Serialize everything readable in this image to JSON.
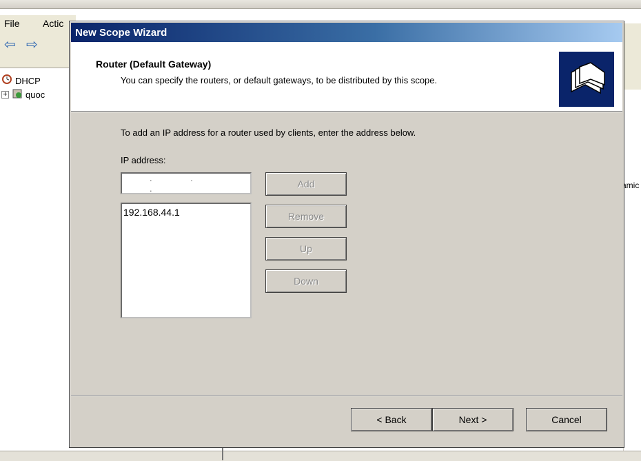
{
  "background_app": {
    "menu": {
      "file": "File",
      "action": "Actic"
    },
    "tree": {
      "root": "DHCP",
      "server": "quoc"
    },
    "clipped_text": "amic"
  },
  "wizard": {
    "title": "New Scope Wizard",
    "header": {
      "title": "Router (Default Gateway)",
      "subtitle": "You can specify the routers, or default gateways, to be distributed by this scope.",
      "icon": "folders-icon"
    },
    "instruction": "To add an IP address for a router used by clients, enter the address below.",
    "ip_label": "IP address:",
    "ip_input_value": ". . .",
    "router_list": [
      "192.168.44.1"
    ],
    "buttons": {
      "add": "Add",
      "remove": "Remove",
      "up": "Up",
      "down": "Down",
      "back": "< Back",
      "next": "Next >",
      "cancel": "Cancel"
    }
  },
  "colors": {
    "titlebar_start": "#0a246a",
    "titlebar_end": "#a6caf0",
    "dialog_face": "#d4d0c8",
    "header_icon_bg": "#0a246a"
  }
}
